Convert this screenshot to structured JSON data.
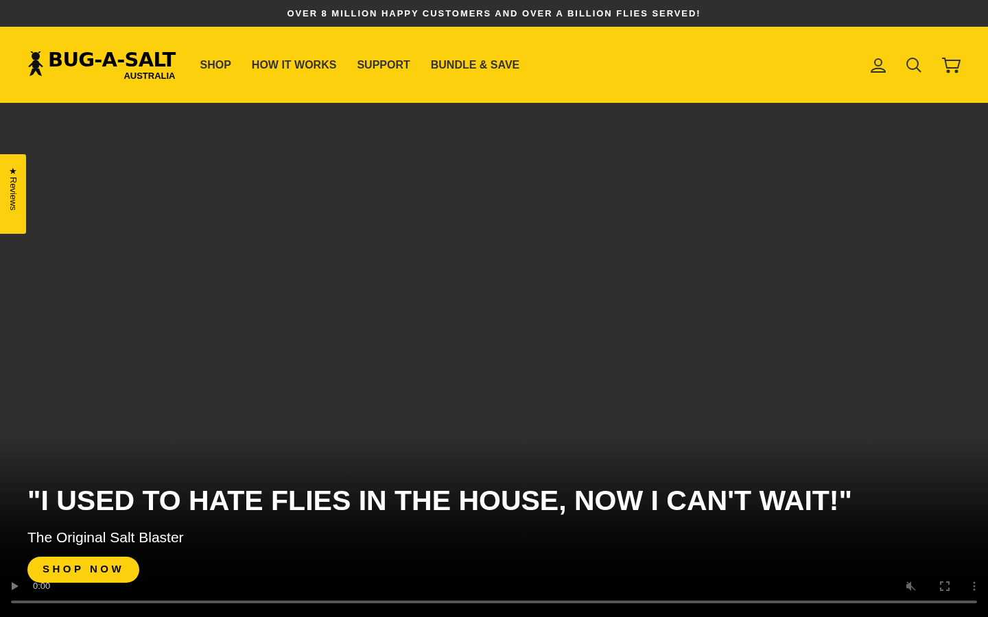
{
  "announcement": "OVER 8 MILLION HAPPY CUSTOMERS AND OVER A BILLION FLIES SERVED!",
  "logo": {
    "name": "BUG-A-SALT",
    "region": "AUSTRALIA"
  },
  "nav": [
    "SHOP",
    "HOW IT WORKS",
    "SUPPORT",
    "BUNDLE & SAVE"
  ],
  "reviews_tab": {
    "icon": "★",
    "label": "Reviews"
  },
  "hero": {
    "headline": "\"I USED TO HATE FLIES IN THE HOUSE, NOW I CAN'T WAIT!\"",
    "subtitle": "The Original Salt Blaster",
    "button": "SHOP NOW"
  },
  "video_controls": {
    "time": "0:00"
  }
}
